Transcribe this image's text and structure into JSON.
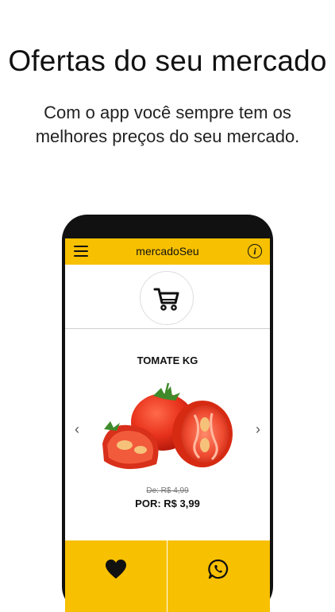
{
  "promo": {
    "title": "Ofertas do seu mercado",
    "subtitle_line1": "Com o app você sempre tem os",
    "subtitle_line2": "melhores preços do seu mercado."
  },
  "app": {
    "title": "mercadoSeu",
    "info_icon_text": "i",
    "accent_color": "#f7c000",
    "icons": [
      "menu-icon",
      "info-icon",
      "cart-icon",
      "chevron-left-icon",
      "chevron-right-icon",
      "heart-icon",
      "whatsapp-icon"
    ]
  },
  "product": {
    "name": "TOMATE KG",
    "old_price": "De: R$ 4,99",
    "new_price": "POR: R$ 3,99",
    "prev_symbol": "‹",
    "next_symbol": "›"
  }
}
